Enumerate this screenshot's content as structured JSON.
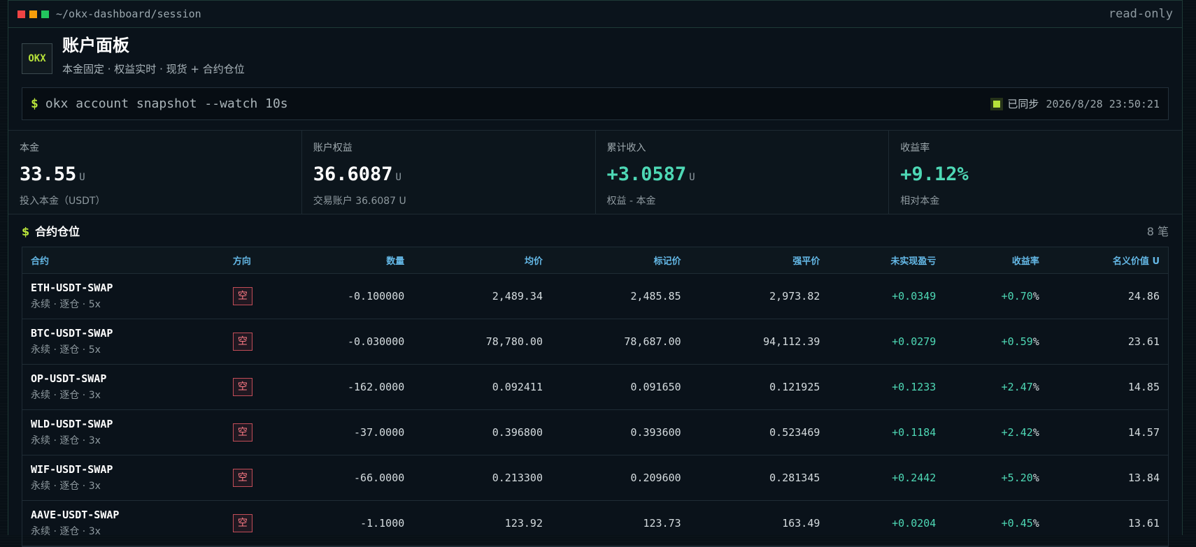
{
  "window": {
    "path": "~/okx-dashboard/session",
    "mode": "read-only"
  },
  "header": {
    "logo": "OKX",
    "title": "账户面板",
    "subtitle": "本金固定 · 权益实时 · 现货 + 合约仓位"
  },
  "command": {
    "prompt": "$",
    "text": "okx account snapshot --watch 10s",
    "sync_label": "已同步",
    "sync_time": "2026/8/28 23:50:21"
  },
  "stats": [
    {
      "label": "本金",
      "value": "33.55",
      "unit": "U",
      "sub": "投入本金（USDT）"
    },
    {
      "label": "账户权益",
      "value": "36.6087",
      "unit": "U",
      "sub": "交易账户 36.6087 U"
    },
    {
      "label": "累计收入",
      "value": "+3.0587",
      "unit": "U",
      "sub": "权益 - 本金"
    },
    {
      "label": "收益率",
      "value": "+9.12%",
      "unit": "",
      "sub": "相对本金"
    }
  ],
  "positions": {
    "prompt": "$",
    "title": "合约仓位",
    "count": "8 笔",
    "columns": {
      "contract": "合约",
      "side": "方向",
      "qty": "数量",
      "avg": "均价",
      "mark": "标记价",
      "liq": "强平价",
      "upnl": "未实现盈亏",
      "roe": "收益率",
      "notional": "名义价值",
      "notional_unit": "U"
    },
    "rows": [
      {
        "symbol": "ETH-USDT-SWAP",
        "meta": "永续 · 逐仓 · 5x",
        "side": "空",
        "qty": "-0.100000",
        "avg": "2,489.34",
        "mark": "2,485.85",
        "liq": "2,973.82",
        "upnl": "+0.0349",
        "roe": "+0.70",
        "notional": "24.86"
      },
      {
        "symbol": "BTC-USDT-SWAP",
        "meta": "永续 · 逐仓 · 5x",
        "side": "空",
        "qty": "-0.030000",
        "avg": "78,780.00",
        "mark": "78,687.00",
        "liq": "94,112.39",
        "upnl": "+0.0279",
        "roe": "+0.59",
        "notional": "23.61"
      },
      {
        "symbol": "OP-USDT-SWAP",
        "meta": "永续 · 逐仓 · 3x",
        "side": "空",
        "qty": "-162.0000",
        "avg": "0.092411",
        "mark": "0.091650",
        "liq": "0.121925",
        "upnl": "+0.1233",
        "roe": "+2.47",
        "notional": "14.85"
      },
      {
        "symbol": "WLD-USDT-SWAP",
        "meta": "永续 · 逐仓 · 3x",
        "side": "空",
        "qty": "-37.0000",
        "avg": "0.396800",
        "mark": "0.393600",
        "liq": "0.523469",
        "upnl": "+0.1184",
        "roe": "+2.42",
        "notional": "14.57"
      },
      {
        "symbol": "WIF-USDT-SWAP",
        "meta": "永续 · 逐仓 · 3x",
        "side": "空",
        "qty": "-66.0000",
        "avg": "0.213300",
        "mark": "0.209600",
        "liq": "0.281345",
        "upnl": "+0.2442",
        "roe": "+5.20",
        "notional": "13.84"
      },
      {
        "symbol": "AAVE-USDT-SWAP",
        "meta": "永续 · 逐仓 · 3x",
        "side": "空",
        "qty": "-1.1000",
        "avg": "123.92",
        "mark": "123.73",
        "liq": "163.49",
        "upnl": "+0.0204",
        "roe": "+0.45",
        "notional": "13.61"
      }
    ]
  },
  "colors": {
    "accent": "#b7e23a",
    "positive": "#4ed8b5",
    "short": "#ff7b86",
    "header": "#64b8e6",
    "window_red": "#ef4444",
    "window_yellow": "#f59e0b",
    "window_green": "#22c55e"
  }
}
